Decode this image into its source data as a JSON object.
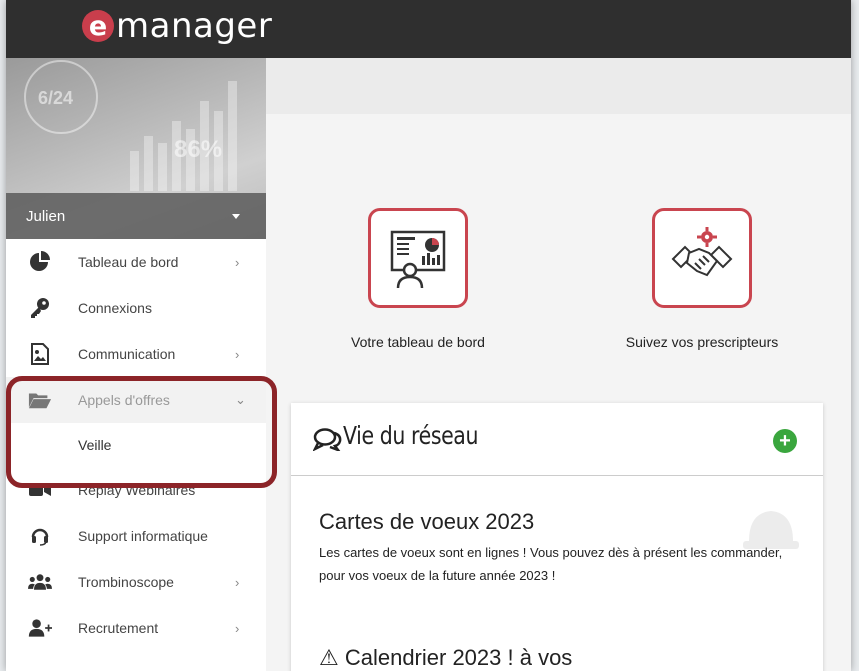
{
  "app": {
    "logo_letter": "e",
    "logo_rest": "manager"
  },
  "user": {
    "name": "Julien"
  },
  "sidebar": {
    "items": [
      {
        "label": "Tableau de bord",
        "icon": "pie-chart-icon",
        "has_arrow": true
      },
      {
        "label": "Connexions",
        "icon": "key-icon",
        "has_arrow": false
      },
      {
        "label": "Communication",
        "icon": "file-image-icon",
        "has_arrow": true
      },
      {
        "label": "Appels d'offres",
        "icon": "folder-open-icon",
        "has_arrow": true,
        "expanded": true
      },
      {
        "label": "Replay Webinaires",
        "icon": "video-camera-icon",
        "has_arrow": false
      },
      {
        "label": "Support informatique",
        "icon": "headset-icon",
        "has_arrow": false
      },
      {
        "label": "Trombinoscope",
        "icon": "users-icon",
        "has_arrow": true
      },
      {
        "label": "Recrutement",
        "icon": "user-plus-icon",
        "has_arrow": true
      }
    ],
    "submenu": {
      "label": "Veille"
    },
    "arrow_right": "›",
    "arrow_down": "⌄"
  },
  "quick_links": [
    {
      "label": "Votre tableau de bord",
      "icon": "presentation-dashboard-icon"
    },
    {
      "label": "Suivez vos prescripteurs",
      "icon": "handshake-gear-icon"
    }
  ],
  "feed": {
    "title": "Vie du réseau",
    "add_label": "+",
    "posts": [
      {
        "title": "Cartes de voeux 2023",
        "body": "Les cartes de voeux sont en lignes ! Vous pouvez dès à présent les commander, pour vos voeux de la future année 2023 !"
      },
      {
        "title": "⚠ Calendrier 2023 ! à vos"
      }
    ]
  },
  "colors": {
    "topbar": "#2f2f2f",
    "accent": "#c93e4c",
    "highlight": "#8c2428",
    "add_button": "#3aa63e"
  }
}
